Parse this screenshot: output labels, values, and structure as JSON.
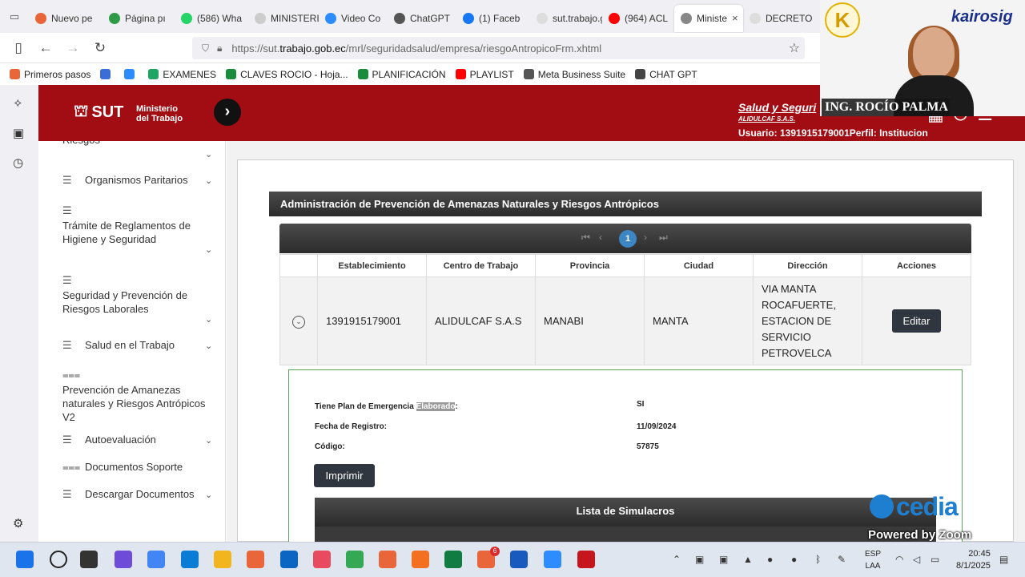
{
  "browser": {
    "tabs": [
      {
        "label": "Nuevo pe",
        "color": "#e8663a"
      },
      {
        "label": "Página pı",
        "color": "#2f9b47"
      },
      {
        "label": "(586) Wha",
        "color": "#25d366"
      },
      {
        "label": "MINISTERIO-",
        "color": "#cccccc"
      },
      {
        "label": "Video Co",
        "color": "#2d8cff"
      },
      {
        "label": "ChatGPT",
        "color": "#555555"
      },
      {
        "label": "(1) Faceb",
        "color": "#1877f2"
      },
      {
        "label": "sut.trabajo.gc",
        "color": "#dddddd"
      },
      {
        "label": "(964) ACL",
        "color": "#ff0000"
      },
      {
        "label": "Ministe",
        "color": "#888888",
        "active": true
      },
      {
        "label": "DECRETO EJE",
        "color": "#dddddd"
      }
    ],
    "url_prefix": "https://sut.",
    "url_domain": "trabajo.gob.ec",
    "url_path": "/mrl/seguridadsalud/empresa/riesgoAntropicoFrm.xhtml",
    "bookmarks": [
      {
        "label": "Primeros pasos",
        "color": "#e8663a"
      },
      {
        "label": "",
        "color": "#3b6dd6"
      },
      {
        "label": "",
        "color": "#2d8cff"
      },
      {
        "label": "EXAMENES",
        "color": "#1fa463"
      },
      {
        "label": "CLAVES ROCIO - Hoja...",
        "color": "#1a8c3c"
      },
      {
        "label": "PLANIFICACIÓN",
        "color": "#1a8c3c"
      },
      {
        "label": "PLAYLIST",
        "color": "#ff0000"
      },
      {
        "label": "Meta Business Suite",
        "color": "#555555"
      },
      {
        "label": "CHAT GPT",
        "color": "#444444"
      }
    ],
    "bookmark_icons": [
      "#d93025",
      "#7b3fa0",
      "#25d366",
      "#1877f2",
      "#111111",
      "#0a66c2",
      "#c13584",
      "#ff0000",
      "#1da1f2"
    ]
  },
  "webcam": {
    "logo_letter": "K",
    "brand": "kairosig",
    "brand_sub": "",
    "name": "ING. ROCÍO PALMA"
  },
  "site": {
    "logo": "SUT",
    "ministry_line1": "Ministerio",
    "ministry_line2": "del Trabajo",
    "title_part": "Salud y Seguri",
    "company": "ALIDULCAF S.A.S.",
    "user_line": "Usuario: 1391915179001Perfil: Institucion"
  },
  "menu": [
    {
      "label": "Riesgos",
      "icon": "",
      "chevron": true
    },
    {
      "label": "Organismos Paritarios",
      "icon": "menu-icon",
      "chevron": true
    },
    {
      "label": "Trámite de Reglamentos de Higiene y Seguridad",
      "icon": "menu-icon",
      "chevron": true
    },
    {
      "label": "Seguridad y Prevención de Riesgos Laborales",
      "icon": "menu-icon",
      "chevron": true
    },
    {
      "label": "Salud en el Trabajo",
      "icon": "menu-icon",
      "chevron": true
    },
    {
      "label": "Prevención de Amanezas naturales y Riesgos Antrópicos V2",
      "icon": "list-icon",
      "chevron": false
    },
    {
      "label": "Autoevaluación",
      "icon": "menu-icon",
      "chevron": true
    },
    {
      "label": "Documentos Soporte",
      "icon": "list-icon",
      "chevron": false
    },
    {
      "label": "Descargar Documentos",
      "icon": "menu-icon",
      "chevron": true
    }
  ],
  "panel": {
    "title": "Administración de Prevención de Amenazas Naturales y Riesgos Antrópicos",
    "page": "1",
    "columns": [
      "Establecimiento",
      "Centro de Trabajo",
      "Provincia",
      "Ciudad",
      "Dirección",
      "Acciones"
    ],
    "row": {
      "establecimiento": "1391915179001",
      "centro": "ALIDULCAF S.A.S",
      "provincia": "MANABI",
      "ciudad": "MANTA",
      "direccion": "VIA MANTA ROCAFUERTE, ESTACION DE SERVICIO PETROVELCA",
      "accion": "Editar"
    },
    "detail": {
      "plan_label_a": "Tiene Plan de Emergencia ",
      "plan_label_hl": "Elaborado",
      "plan_label_b": ":",
      "plan_value": "SI",
      "fecha_label": "Fecha de Registro:",
      "fecha_value": "11/09/2024",
      "codigo_label": "Código:",
      "codigo_value": "57875",
      "print_label": "Imprimir"
    },
    "simulacros_title": "Lista de Simulacros"
  },
  "overlay": {
    "cedia": "cedia",
    "powered": "Powered by Zoom"
  },
  "taskbar": {
    "apps": [
      "#1a73e8",
      "#222222",
      "#333333",
      "#6e4bd8",
      "#4285f4",
      "#0a7cd6",
      "#f2b51d",
      "#e8663a",
      "#0a66c2",
      "#e84a5f",
      "#34a853",
      "#e8663a",
      "#f37021",
      "#107c41",
      "#e8663a",
      "#185abd",
      "#2d8cff",
      "#c4161c"
    ],
    "badge": "6",
    "lang1": "ESP",
    "lang2": "LAA",
    "time": "20:45",
    "date": "8/1/2025"
  }
}
